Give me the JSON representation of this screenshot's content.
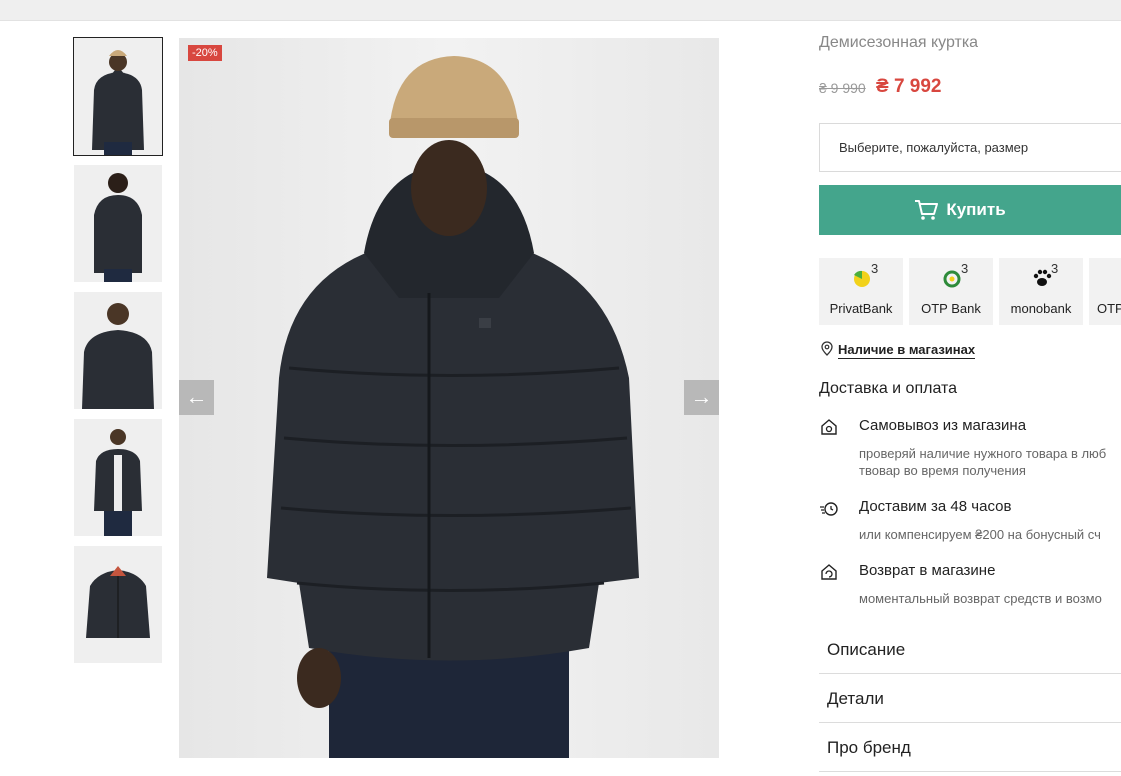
{
  "product": {
    "title": "Демисезонная куртка",
    "old_price": "₴ 9 990",
    "new_price": "₴ 7 992",
    "discount_badge": "-20%"
  },
  "size_select": {
    "placeholder": "Выберите, пожалуйста, размер"
  },
  "buy_button": {
    "label": "Купить",
    "color": "#44a58c"
  },
  "installments": [
    {
      "name": "PrivatBank",
      "count": "3",
      "icon": "privatbank-logo"
    },
    {
      "name": "OTP Bank",
      "count": "3",
      "icon": "otp-bank-logo"
    },
    {
      "name": "monobank",
      "count": "3",
      "icon": "monobank-paw-logo"
    },
    {
      "name": "OTP",
      "count": "",
      "icon": "otp-logo"
    }
  ],
  "availability_link": "Наличие в магазинах",
  "delivery": {
    "heading": "Доставка и оплата",
    "items": [
      {
        "title": "Самовывоз из магазина",
        "subtitle_lines": [
          "проверяй наличие нужного товара в люб",
          "твовар во время получения"
        ]
      },
      {
        "title": "Доставим за 48 часов",
        "subtitle_lines": [
          "или компенсируем ₴200 на бонусный сч"
        ]
      },
      {
        "title": "Возврат в магазине",
        "subtitle_lines": [
          "моментальный возврат средств и возмо"
        ]
      }
    ]
  },
  "accordion": [
    "Описание",
    "Детали",
    "Про бренд"
  ],
  "gallery": {
    "thumbnail_count": 5,
    "prev_arrow": "←",
    "next_arrow": "→"
  },
  "colors": {
    "sale": "#d8473f",
    "jacket": "#2a2e35",
    "beanie": "#c9a97a"
  }
}
